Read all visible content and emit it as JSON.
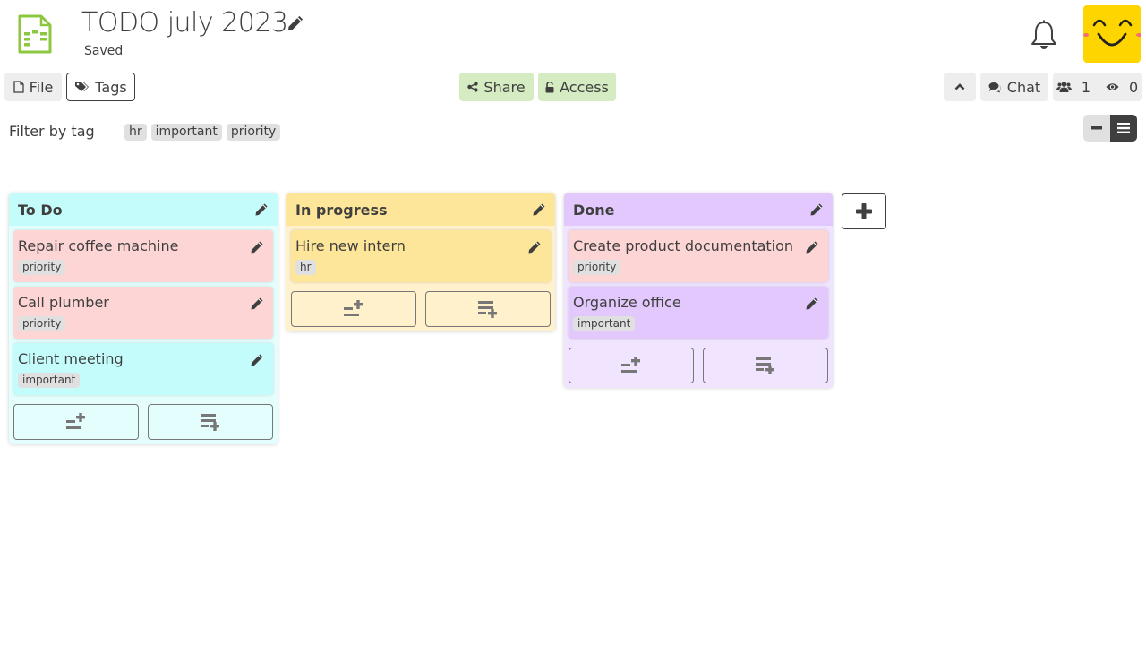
{
  "header": {
    "title": "TODO july 2023",
    "status": "Saved",
    "file_icon": "kanban-file-icon",
    "edit_icon": "pencil-icon",
    "notification_icon": "bell-icon",
    "avatar": "smiley-avatar"
  },
  "toolbar": {
    "file_label": "File",
    "tags_label": "Tags",
    "share_label": "Share",
    "access_label": "Access",
    "collapse_icon": "chevron-up-icon",
    "chat_label": "Chat",
    "users_count": "1",
    "viewers_count": "0"
  },
  "filter": {
    "label": "Filter by tag",
    "tags": [
      "hr",
      "important",
      "priority"
    ]
  },
  "colors": {
    "accent_green": "#8dc63f",
    "share_bg": "#d5ecc2",
    "todo_head": "#c4fcfc",
    "todo_body": "#e4fefe",
    "progress_head": "#fde59a",
    "progress_body": "#fff1cc",
    "done_head": "#e2c8fc",
    "done_body": "#f0e4fe",
    "priority_card": "#fed5d5",
    "tag_bg": "#e0e0e0",
    "avatar_bg": "#ffd500"
  },
  "board": {
    "columns": [
      {
        "title": "To Do",
        "items": [
          {
            "title": "Repair coffee machine",
            "tag": "priority"
          },
          {
            "title": "Call plumber",
            "tag": "priority"
          },
          {
            "title": "Client meeting",
            "tag": "important"
          }
        ]
      },
      {
        "title": "In progress",
        "items": [
          {
            "title": "Hire new intern",
            "tag": "hr"
          }
        ]
      },
      {
        "title": "Done",
        "items": [
          {
            "title": "Create product documentation",
            "tag": "priority"
          },
          {
            "title": "Organize office",
            "tag": "important"
          }
        ]
      }
    ]
  }
}
